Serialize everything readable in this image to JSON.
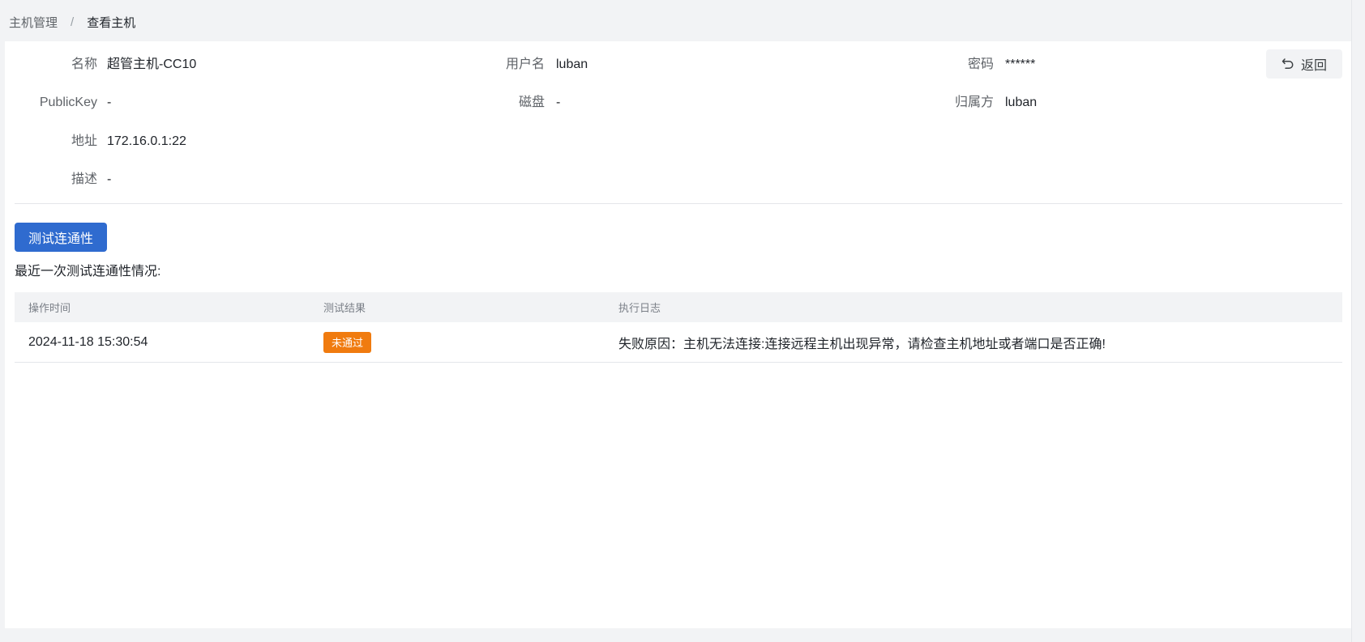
{
  "breadcrumb": {
    "parent": "主机管理",
    "separator": "/",
    "current": "查看主机"
  },
  "details": {
    "name_label": "名称",
    "name_value": "超管主机-CC10",
    "username_label": "用户名",
    "username_value": "luban",
    "password_label": "密码",
    "password_value": "******",
    "publickey_label": "PublicKey",
    "publickey_value": "-",
    "disk_label": "磁盘",
    "disk_value": "-",
    "owner_label": "归属方",
    "owner_value": "luban",
    "address_label": "地址",
    "address_value": "172.16.0.1:22",
    "description_label": "描述",
    "description_value": "-"
  },
  "actions": {
    "back_label": "返回",
    "back_icon": "undo-arrow-icon",
    "test_label": "测试连通性"
  },
  "connectivity": {
    "caption": "最近一次测试连通性情况:",
    "columns": [
      "操作时间",
      "测试结果",
      "执行日志"
    ],
    "rows": [
      {
        "time": "2024-11-18 15:30:54",
        "result": "未通过",
        "log": "失败原因：主机无法连接:连接远程主机出现异常，请检查主机地址或者端口是否正确!"
      }
    ]
  },
  "colors": {
    "primary": "#2f6bcf",
    "fail_badge": "#f07b0f",
    "page_bg": "#f2f3f5"
  }
}
